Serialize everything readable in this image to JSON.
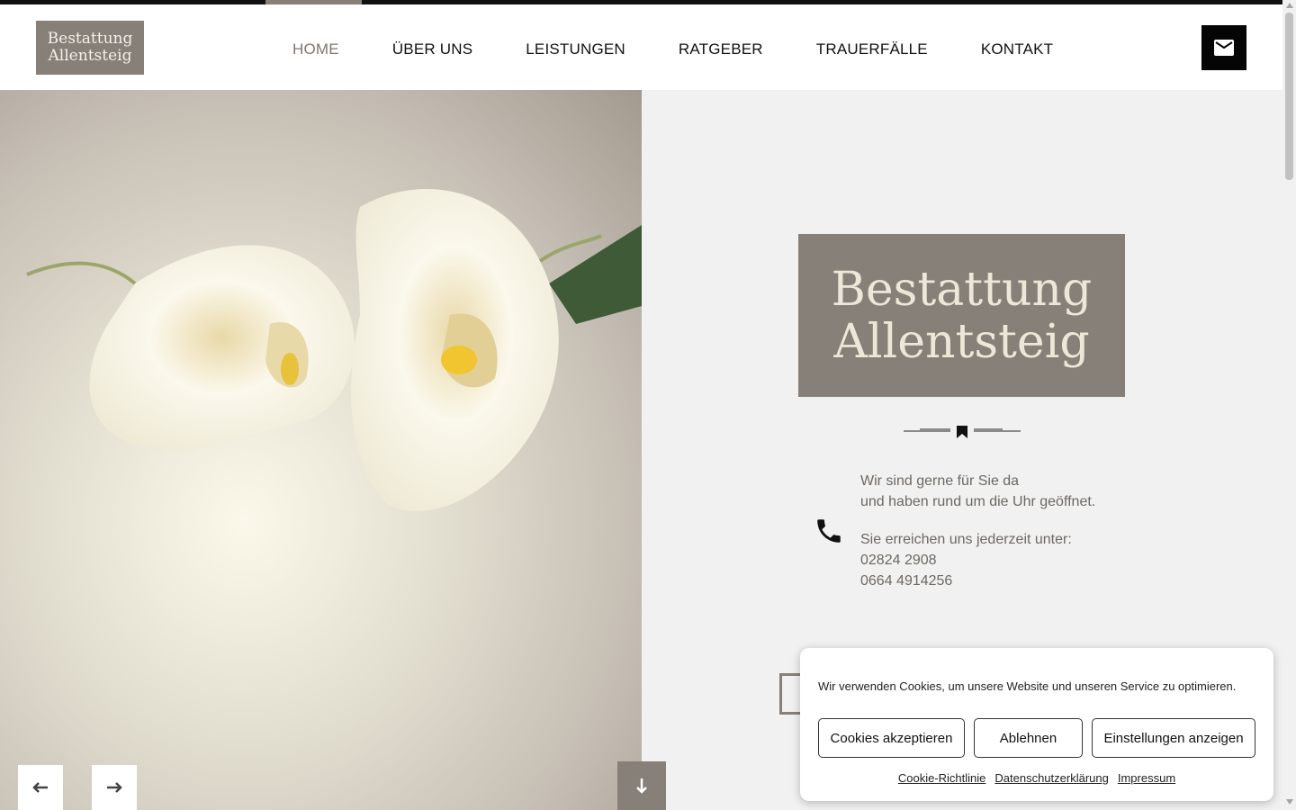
{
  "header": {
    "logo_line1": "Bestattung",
    "logo_line2": "Allentsteig",
    "nav": [
      {
        "label": "HOME"
      },
      {
        "label": "ÜBER UNS"
      },
      {
        "label": "LEISTUNGEN"
      },
      {
        "label": "RATGEBER"
      },
      {
        "label": "TRAUERFÄLLE"
      },
      {
        "label": "KONTAKT"
      }
    ],
    "mail_icon": "mail-icon"
  },
  "hero": {
    "image": "calla-lily-flowers",
    "logo_line1": "Bestattung",
    "logo_line2": "Allentsteig",
    "contact": {
      "line1": "Wir sind gerne für Sie da",
      "line2": "und haben rund um die Uhr geöffnet.",
      "line3": "Sie erreichen uns jederzeit unter:",
      "phone1": "02824 2908",
      "phone2": "0664 4914256"
    }
  },
  "cookie": {
    "message": "Wir verwenden Cookies, um unsere Website und unseren Service zu optimieren.",
    "accept": "Cookies akzeptieren",
    "reject": "Ablehnen",
    "settings": "Einstellungen anzeigen",
    "link_policy": "Cookie-Richtlinie",
    "link_privacy": "Datenschutzerklärung",
    "link_imprint": "Impressum"
  },
  "colors": {
    "brand": "#878078",
    "dark": "#050505",
    "panel": "#f1f1f1"
  }
}
